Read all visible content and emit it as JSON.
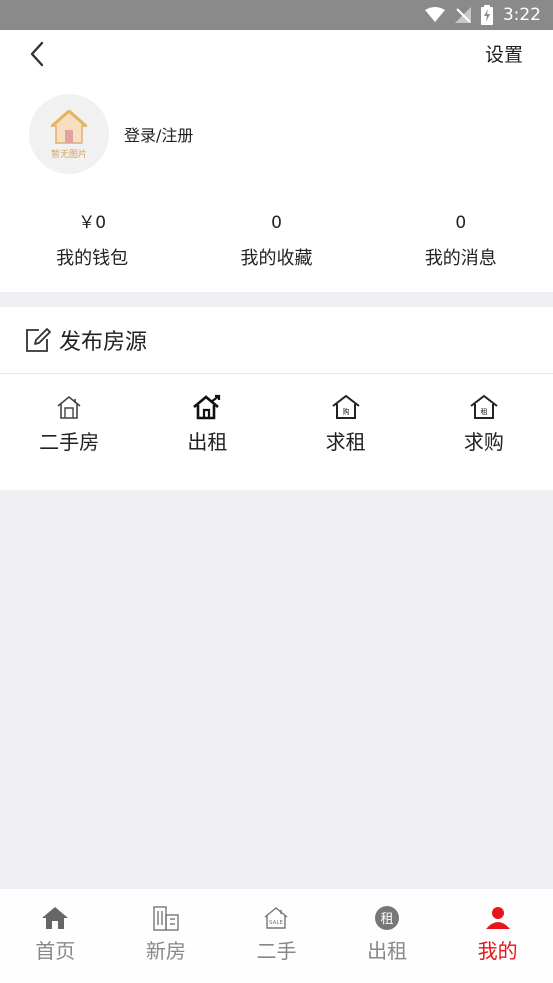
{
  "status_bar": {
    "time": "3:22"
  },
  "header": {
    "settings_label": "设置"
  },
  "profile": {
    "avatar_caption": "暂无图片",
    "login_label": "登录/注册"
  },
  "stats": [
    {
      "value": "￥0",
      "label": "我的钱包"
    },
    {
      "value": "0",
      "label": "我的收藏"
    },
    {
      "value": "0",
      "label": "我的消息"
    }
  ],
  "publish": {
    "title": "发布房源",
    "actions": [
      {
        "label": "二手房",
        "icon": "house-sale-icon"
      },
      {
        "label": "出租",
        "icon": "house-rent-icon"
      },
      {
        "label": "求租",
        "icon": "house-buy-request-icon"
      },
      {
        "label": "求购",
        "icon": "house-rent-request-icon"
      }
    ]
  },
  "tabbar": {
    "active_color": "#e8141a",
    "items": [
      {
        "label": "首页",
        "icon": "home-icon"
      },
      {
        "label": "新房",
        "icon": "building-icon"
      },
      {
        "label": "二手",
        "icon": "sale-house-icon"
      },
      {
        "label": "出租",
        "icon": "rent-badge-icon"
      },
      {
        "label": "我的",
        "icon": "user-icon"
      }
    ]
  }
}
